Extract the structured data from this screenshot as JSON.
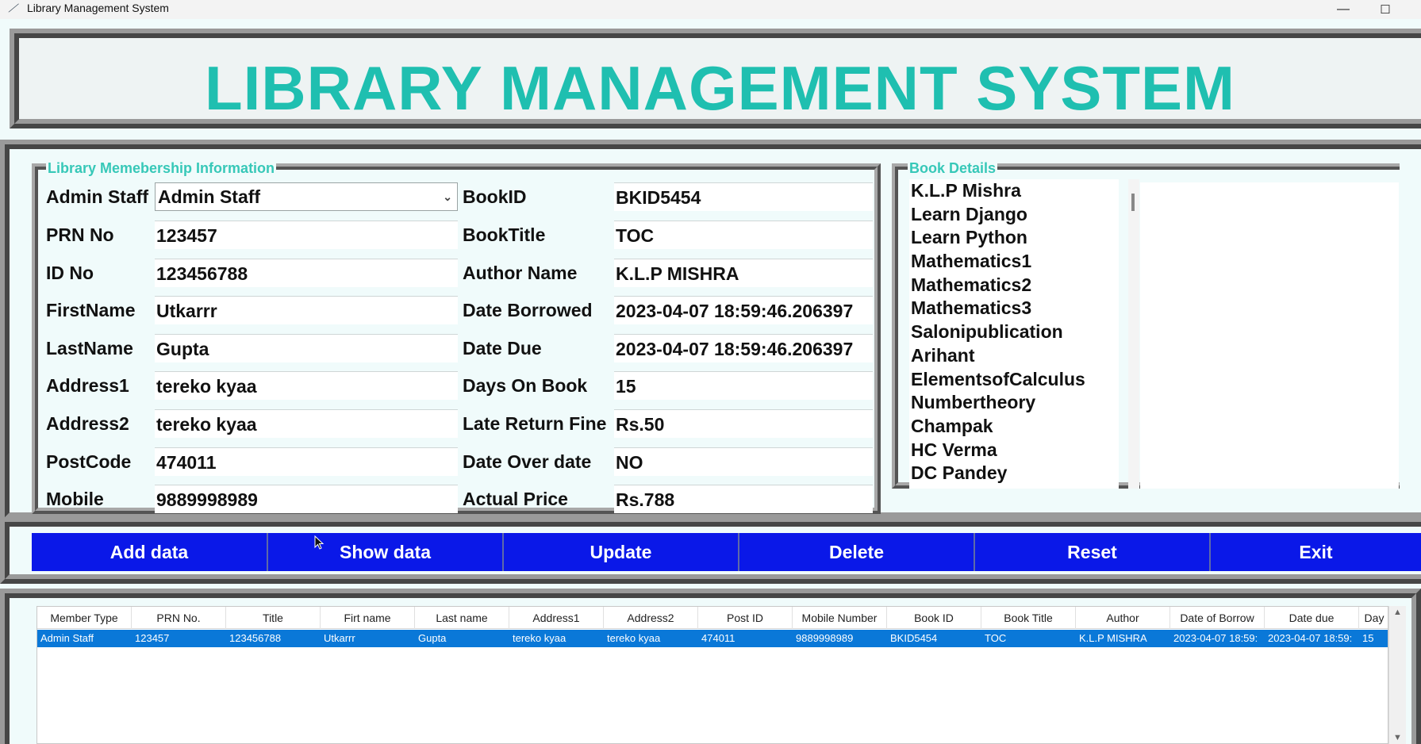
{
  "window": {
    "title": "Library Management System",
    "minimize": "—",
    "maximize": "☐",
    "icon": "feather-icon"
  },
  "header": {
    "title": "LIBRARY MANAGEMENT SYSTEM"
  },
  "membership": {
    "caption": "Library Memebership Information",
    "fields": [
      {
        "label": "Admin Staff",
        "value": "Admin Staff",
        "type": "combo"
      },
      {
        "label": "PRN No",
        "value": "123457"
      },
      {
        "label": "ID No",
        "value": "123456788"
      },
      {
        "label": "FirstName",
        "value": "Utkarrr"
      },
      {
        "label": "LastName",
        "value": "Gupta"
      },
      {
        "label": "Address1",
        "value": "tereko kyaa"
      },
      {
        "label": "Address2",
        "value": "tereko kyaa"
      },
      {
        "label": "PostCode",
        "value": "474011"
      },
      {
        "label": "Mobile",
        "value": "9889998989"
      }
    ],
    "book_fields": [
      {
        "label": "BookID",
        "value": "BKID5454"
      },
      {
        "label": "BookTitle",
        "value": "TOC"
      },
      {
        "label": "Author Name",
        "value": "K.L.P MISHRA"
      },
      {
        "label": "Date Borrowed",
        "value": "2023-04-07 18:59:46.206397"
      },
      {
        "label": "Date Due",
        "value": "2023-04-07 18:59:46.206397"
      },
      {
        "label": "Days On Book",
        "value": "15"
      },
      {
        "label": "Late Return Fine",
        "value": "Rs.50"
      },
      {
        "label": "Date Over date",
        "value": "NO"
      },
      {
        "label": "Actual Price",
        "value": "Rs.788"
      }
    ]
  },
  "book_details": {
    "caption": "Book Details",
    "items": [
      "K.L.P Mishra",
      "Learn Django",
      "Learn Python",
      "Mathematics1",
      "Mathematics2",
      "Mathematics3",
      "Salonipublication",
      "Arihant",
      "ElementsofCalculus",
      "Numbertheory",
      "Champak",
      "HC Verma",
      "DC Pandey"
    ]
  },
  "buttons": [
    "Add data",
    "Show data",
    "Update",
    "Delete",
    "Reset",
    "Exit"
  ],
  "table": {
    "columns": [
      "Member Type",
      "PRN No.",
      "Title",
      "Firt name",
      "Last name",
      "Address1",
      "Address2",
      "Post ID",
      "Mobile Number",
      "Book ID",
      "Book Title",
      "Author",
      "Date of Borrow",
      "Date due",
      "Day"
    ],
    "rows": [
      [
        "Admin Staff",
        "123457",
        "123456788",
        "Utkarrr",
        "Gupta",
        "tereko kyaa",
        "tereko kyaa",
        "474011",
        "9889998989",
        "BKID5454",
        "TOC",
        "K.L.P MISHRA",
        "2023-04-07 18:59:",
        "2023-04-07 18:59:",
        "15"
      ]
    ]
  }
}
